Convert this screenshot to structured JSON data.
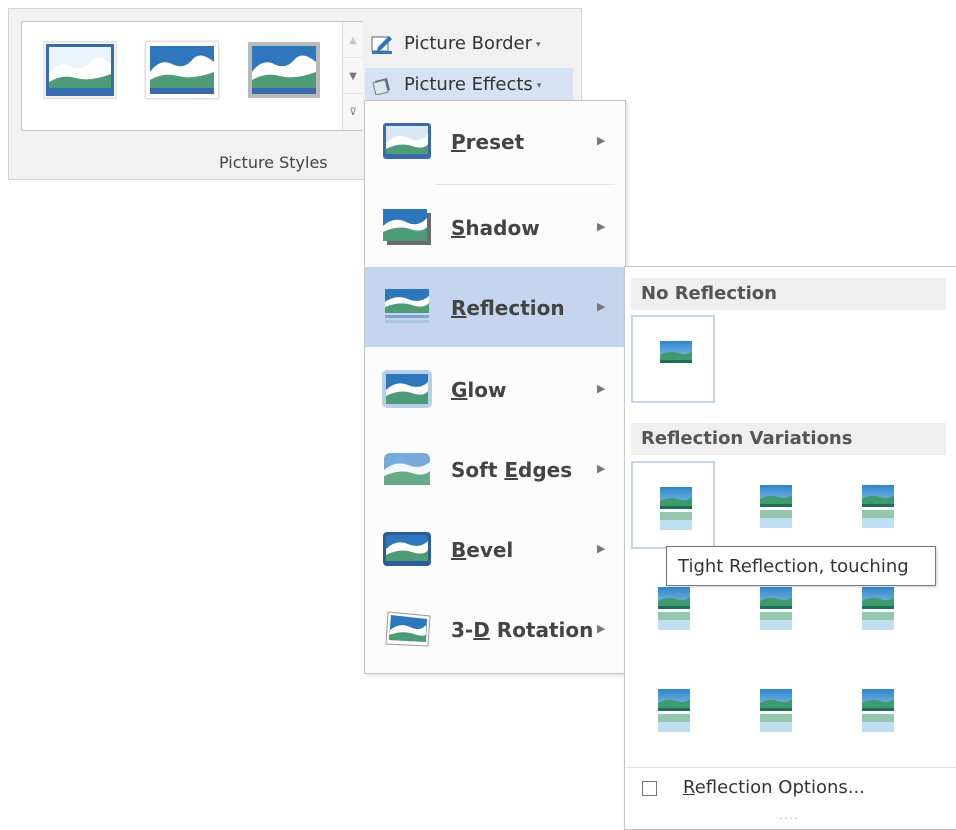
{
  "ribbon": {
    "group_label": "Picture Styles",
    "picture_border_label": "Picture Border",
    "picture_effects_label": "Picture Effects",
    "dropdown_glyph": "▾",
    "gallery_up_glyph": "▲",
    "gallery_down_glyph": "▼",
    "gallery_more_glyph": "⊽"
  },
  "effects_menu": {
    "submenu_arrow_glyph": "▶",
    "items": [
      {
        "pre": "",
        "accel": "P",
        "post": "reset",
        "icon": "preset-icon"
      },
      {
        "pre": "",
        "accel": "S",
        "post": "hadow",
        "icon": "shadow-icon"
      },
      {
        "pre": "",
        "accel": "R",
        "post": "eflection",
        "icon": "reflection-icon",
        "highlighted": true
      },
      {
        "pre": "",
        "accel": "G",
        "post": "low",
        "icon": "glow-icon"
      },
      {
        "pre": "Soft ",
        "accel": "E",
        "post": "dges",
        "icon": "soft-edges-icon"
      },
      {
        "pre": "",
        "accel": "B",
        "post": "evel",
        "icon": "bevel-icon"
      },
      {
        "pre": "3-",
        "accel": "D",
        "post": " Rotation",
        "icon": "3d-rotation-icon"
      }
    ]
  },
  "reflection_submenu": {
    "no_reflection_header": "No Reflection",
    "variations_header": "Reflection Variations",
    "options_pre": "",
    "options_accel": "R",
    "options_post": "eflection Options...",
    "grip": "....",
    "selected_index": 0
  },
  "tooltip": {
    "text": "Tight Reflection, touching"
  },
  "colors": {
    "sky": "#2f86c9",
    "land": "#3f9a6e",
    "menu_highlight": "#c5d5ef",
    "button_highlight": "#d6e1f2"
  }
}
